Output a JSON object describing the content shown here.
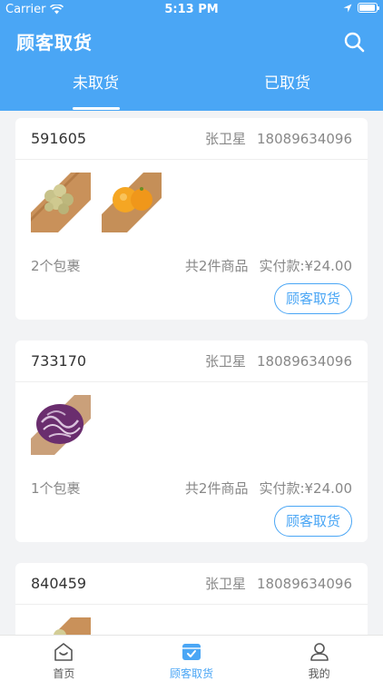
{
  "status_bar": {
    "carrier": "Carrier",
    "time": "5:13 PM"
  },
  "header": {
    "title": "顾客取货",
    "search_icon": "search-icon"
  },
  "tabs": [
    {
      "label": "未取货",
      "active": true
    },
    {
      "label": "已取货",
      "active": false
    }
  ],
  "orders": [
    {
      "order_no": "591605",
      "customer_name": "张卫星",
      "phone": "18089634096",
      "items": [
        "longan-thumbnail",
        "orange-thumbnail"
      ],
      "packages": "2个包裹",
      "total_items": "共2件商品",
      "payment": "实付款:¥24.00",
      "action": "顾客取货"
    },
    {
      "order_no": "733170",
      "customer_name": "张卫星",
      "phone": "18089634096",
      "items": [
        "purple-cabbage-thumbnail"
      ],
      "packages": "1个包裹",
      "total_items": "共2件商品",
      "payment": "实付款:¥24.00",
      "action": "顾客取货"
    },
    {
      "order_no": "840459",
      "customer_name": "张卫星",
      "phone": "18089634096",
      "items": [
        "longan-thumbnail"
      ]
    }
  ],
  "tabbar": [
    {
      "label": "首页",
      "icon": "home-icon",
      "active": false
    },
    {
      "label": "顾客取货",
      "icon": "pickup-icon",
      "active": true
    },
    {
      "label": "我的",
      "icon": "user-icon",
      "active": false
    }
  ],
  "colors": {
    "primary": "#4aa6f5",
    "background": "#f2f3f5"
  }
}
